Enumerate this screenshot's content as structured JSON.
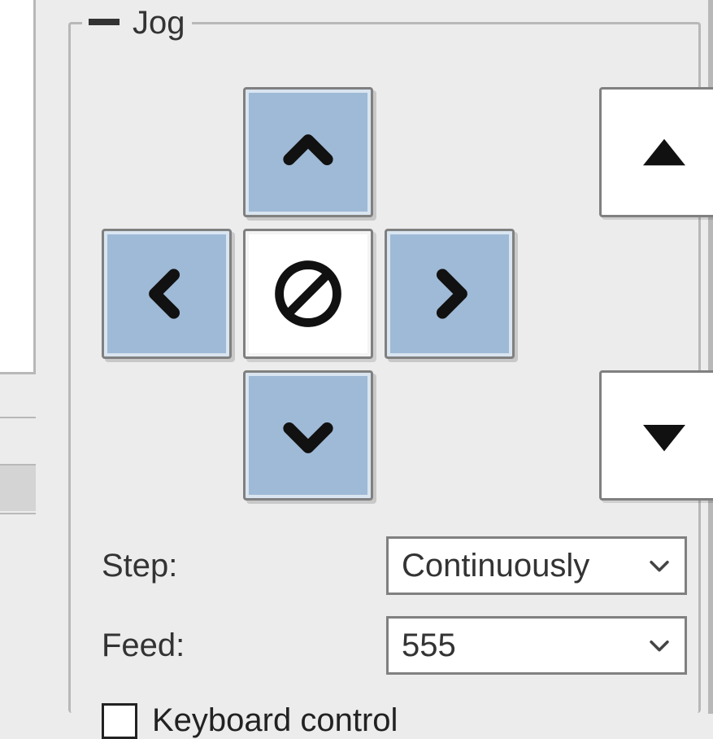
{
  "panel": {
    "title": "Jog",
    "collapsed_icon": "dash-icon"
  },
  "jog": {
    "buttons": {
      "y_plus": "chevron-up-icon",
      "y_minus": "chevron-down-icon",
      "x_minus": "chevron-left-icon",
      "x_plus": "chevron-right-icon",
      "stop": "no-entry-icon",
      "z_plus": "triangle-up-icon",
      "z_minus": "triangle-down-icon"
    }
  },
  "form": {
    "step_label": "Step:",
    "step_value": "Continuously",
    "feed_label": "Feed:",
    "feed_value": "555",
    "keyboard_checked": false,
    "keyboard_label": "Keyboard control"
  },
  "colors": {
    "button_blue": "#9fbad6",
    "panel_bg": "#ececec",
    "border": "#808080"
  }
}
